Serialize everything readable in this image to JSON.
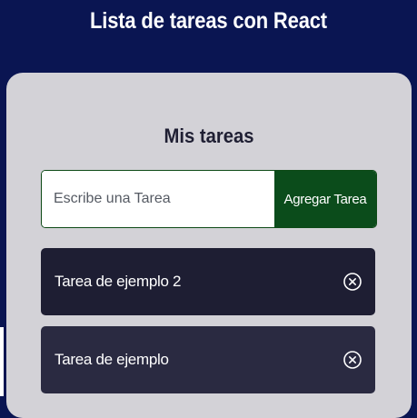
{
  "header": {
    "title": "Lista de tareas con React"
  },
  "card": {
    "title": "Mis tareas"
  },
  "form": {
    "placeholder": "Escribe una Tarea",
    "value": "",
    "submit_label": "Agregar Tarea"
  },
  "tasks": [
    {
      "text": "Tarea de ejemplo 2",
      "delete_icon": "circle-x-icon"
    },
    {
      "text": "Tarea de ejemplo",
      "delete_icon": "circle-x-icon"
    }
  ],
  "colors": {
    "page_background": "#0a1552",
    "card_background": "#d3d2d7",
    "button_background": "#0b4c1b",
    "task_background": "#1e1e33",
    "task_background_alt": "#2a2a41"
  }
}
